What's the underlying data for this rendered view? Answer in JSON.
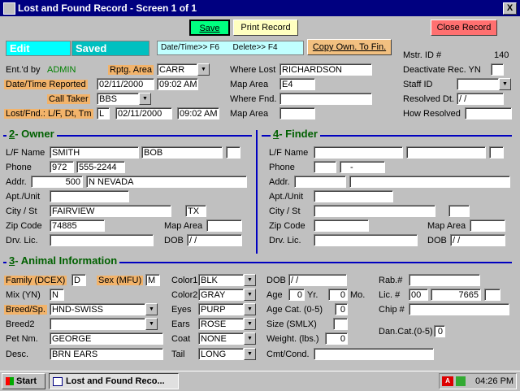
{
  "window": {
    "title": "Lost and Found Record - Screen 1 of 1",
    "close": "X"
  },
  "toolbar": {
    "status_edit": "Edit",
    "status_saved": "Saved",
    "save": "Save",
    "print": "Print Record",
    "shortcuts": "Date/Time>> F6      Delete>> F4",
    "copy": "Copy Own. To Fin.",
    "close": "Close Record"
  },
  "header": {
    "mstr_label": "Mstr. ID #",
    "mstr_value": "140",
    "entd_label": "Ent.'d by",
    "entd_value": "ADMIN",
    "rptg_label": "Rptg. Area",
    "rptg_value": "CARR",
    "where_lost_label": "Where Lost",
    "where_lost_value": "RICHARDSON",
    "deact_label": "Deactivate Rec. YN",
    "dt_reported_label": "Date/Time Reported",
    "dt_reported_date": "02/11/2000",
    "dt_reported_time": "09:02 AM",
    "map_area_label": "Map Area",
    "map_area_value": "E4",
    "staff_label": "Staff ID",
    "call_taker_label": "Call Taker",
    "call_taker_value": "BBS",
    "where_fnd_label": "Where Fnd.",
    "resolved_label": "Resolved Dt.",
    "resolved_value": " / /",
    "lostfnd_label": "Lost/Fnd.: L/F, Dt, Tm",
    "lostfnd_lf": "L",
    "lostfnd_date": "02/11/2000",
    "lostfnd_time": "09:02 AM",
    "map_area2_label": "Map Area",
    "how_resolved_label": "How Resolved"
  },
  "owner": {
    "heading_num": "2",
    "heading": "- Owner",
    "lf_name_label": "L/F Name",
    "last": "SMITH",
    "first": "BOB",
    "phone_label": "Phone",
    "area": "972",
    "number": "555-2244",
    "addr_label": "Addr.",
    "addr_num": "500",
    "addr_street": "N NEVADA",
    "apt_label": "Apt./Unit",
    "city_label": "City / St",
    "city": "FAIRVIEW",
    "state": "TX",
    "zip_label": "Zip Code",
    "zip": "74885",
    "map_label": "Map Area",
    "drv_label": "Drv. Lic.",
    "dob_label": "DOB",
    "dob": " / /"
  },
  "finder": {
    "heading_num": "4",
    "heading": "- Finder",
    "lf_name_label": "L/F Name",
    "phone_label": "Phone",
    "phone_sep": "-",
    "addr_label": "Addr.",
    "apt_label": "Apt./Unit",
    "city_label": "City / St",
    "zip_label": "Zip Code",
    "map_label": "Map Area",
    "drv_label": "Drv. Lic.",
    "dob_label": "DOB",
    "dob": " / /"
  },
  "animal": {
    "heading_num": "3",
    "heading": "- Animal Information",
    "family_label": "Family (DCEX)",
    "family": "D",
    "sex_label": "Sex (MFU)",
    "sex": "M",
    "mix_label": "Mix (YN)",
    "mix": "N",
    "breed_label": "Breed/Sp.",
    "breed": "HND-SWISS",
    "breed2_label": "Breed2",
    "pet_label": "Pet Nm.",
    "pet": "GEORGE",
    "desc_label": "Desc.",
    "desc": "BRN EARS",
    "color1_label": "Color1",
    "color1": "BLK",
    "color2_label": "Color2",
    "color2": "GRAY",
    "eyes_label": "Eyes",
    "eyes": "PURP",
    "ears_label": "Ears",
    "ears": "ROSE",
    "coat_label": "Coat",
    "coat": "NONE",
    "tail_label": "Tail",
    "tail": "LONG",
    "dob_label": "DOB",
    "dob": " / /",
    "age_label": "Age",
    "age_yr": "0",
    "yr_label": "Yr.",
    "age_mo": "0",
    "mo_label": "Mo.",
    "agecat_label": "Age Cat. (0-5)",
    "agecat": "0",
    "size_label": "Size (SMLX)",
    "weight_label": "Weight. (lbs.)",
    "weight": "0",
    "cmt_label": "Cmt/Cond.",
    "rab_label": "Rab.#",
    "lic_label": "Lic. #",
    "lic_yr": "00",
    "lic_num": "7665",
    "chip_label": "Chip #",
    "dancat_label": "Dan.Cat.(0-5)",
    "dancat": "0"
  },
  "taskbar": {
    "start": "Start",
    "task": "Lost and Found Reco...",
    "clock": "04:26 PM"
  }
}
